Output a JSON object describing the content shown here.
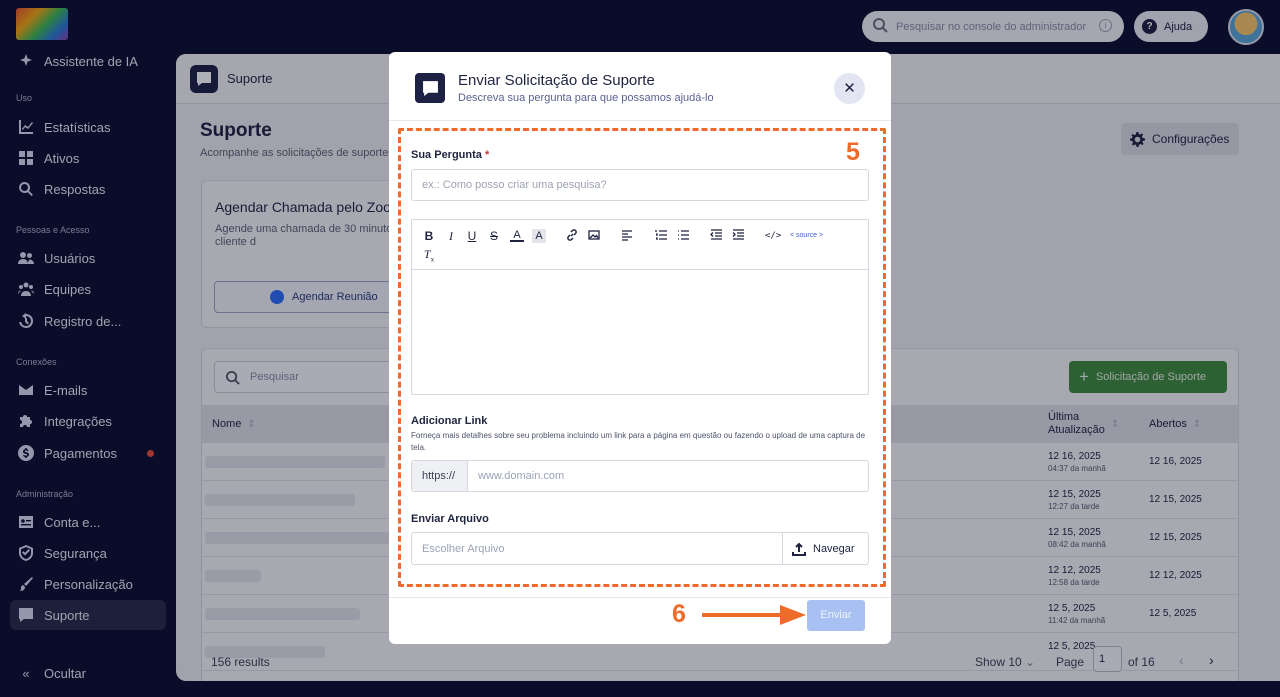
{
  "sidebar": {
    "items": {
      "assistant": "Assistente de IA",
      "stats": "Estatísticas",
      "assets": "Ativos",
      "answers": "Respostas",
      "users": "Usuários",
      "teams": "Equipes",
      "log": "Registro de...",
      "emails": "E-mails",
      "integrations": "Integrações",
      "payments": "Pagamentos",
      "account": "Conta e...",
      "security": "Segurança",
      "personalization": "Personalização",
      "support": "Suporte",
      "hide": "Ocultar"
    },
    "sections": {
      "use": "Uso",
      "people": "Pessoas e Acesso",
      "connections": "Conexões",
      "admin": "Administração"
    }
  },
  "topbar": {
    "search_placeholder": "Pesquisar no console do administrador",
    "help_label": "Ajuda"
  },
  "page": {
    "header_title": "Suporte",
    "title": "Suporte",
    "subtitle": "Acompanhe as solicitações de suporte",
    "settings_label": "Configurações",
    "zoom_card": {
      "title": "Agendar Chamada pelo Zoo",
      "description": "Agende uma chamada de 30 minuto um gerente de sucesso do cliente d",
      "button": "Agendar Reunião"
    },
    "table": {
      "search_placeholder": "Pesquisar",
      "add_button": "Solicitação de Suporte",
      "columns": {
        "name": "Nome",
        "last_update": "Última Atualização",
        "opened": "Abertos"
      },
      "rows": [
        {
          "date": "12 16, 2025",
          "time": "04:37 da manhã",
          "opened": "12 16, 2025"
        },
        {
          "date": "12 15, 2025",
          "time": "12:27 da tarde",
          "opened": "12 15, 2025"
        },
        {
          "date": "12 15, 2025",
          "time": "08:42 da manhã",
          "opened": "12 15, 2025"
        },
        {
          "date": "12 12, 2025",
          "time": "12:58 da tarde",
          "opened": "12 12, 2025"
        },
        {
          "date": "12 5, 2025",
          "time": "11:42 da manhã",
          "opened": "12 5, 2025"
        },
        {
          "date": "12 5, 2025",
          "time": "",
          "opened": ""
        }
      ],
      "results": "156 results",
      "show": "Show 10",
      "page_label": "Page",
      "page_value": "1",
      "of_pages": "of 16"
    }
  },
  "modal": {
    "title": "Enviar Solicitação de Suporte",
    "subtitle": "Descreva sua pergunta para que possamos ajudá-lo",
    "close": "✕",
    "step_a": "5",
    "step_b": "6",
    "question_label": "Sua Pergunta",
    "required_mark": "*",
    "question_placeholder": "ex.: Como posso criar uma pesquisa?",
    "source_label": "< source >",
    "link_label": "Adicionar Link",
    "link_hint": "Forneça mais detalhes sobre seu problema incluindo um link para a página em questão ou fazendo o upload de uma captura de tela.",
    "link_prefix": "https://",
    "link_placeholder": "www.domain.com",
    "file_label": "Enviar Arquivo",
    "file_placeholder": "Escolher Arquivo",
    "browse": "Navegar",
    "send": "Enviar"
  },
  "colors": {
    "accent": "#ee6b2a",
    "primary": "#1d2245",
    "success": "#3f8a3c",
    "send_disabled": "#a9c1f2"
  }
}
